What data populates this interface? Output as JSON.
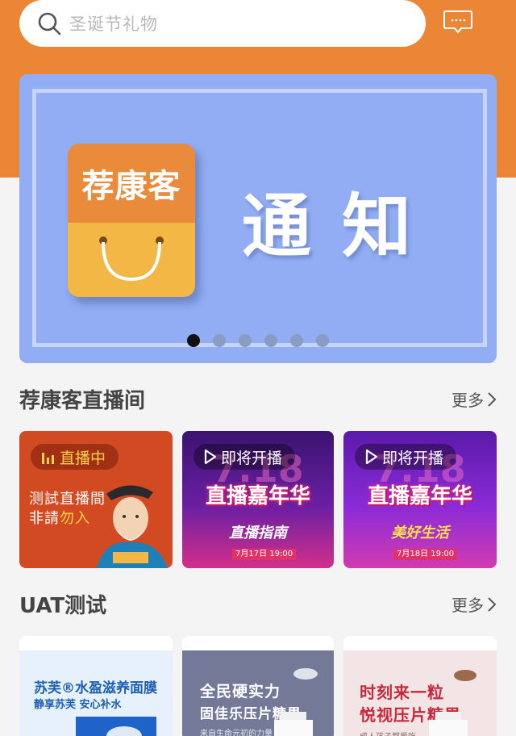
{
  "search": {
    "placeholder": "圣诞节礼物"
  },
  "banner": {
    "logo_text": "荐康客",
    "notice_text": "通知",
    "dots_count": 6,
    "active_dot": 0
  },
  "live_section": {
    "title": "荐康客直播间",
    "more_label": "更多",
    "cards": [
      {
        "status": "直播中",
        "line1": "测試直播間",
        "line2_prefix": "非請",
        "line2_highlight": "勿入"
      },
      {
        "status": "即将开播",
        "big_num": "7.18",
        "title": "直播嘉年华",
        "subtitle": "直播指南",
        "date": "7月17日 19:00"
      },
      {
        "status": "即将开播",
        "big_num": "7.18",
        "title": "直播嘉年华",
        "subtitle": "美好生活",
        "date": "7月18日 19:00"
      }
    ]
  },
  "uat_section": {
    "title": "UAT测试",
    "more_label": "更多",
    "products": [
      {
        "line1": "苏芙®水盈滋养面膜",
        "line2": "静享苏芙 安心补水"
      },
      {
        "line1": "全民硬实力",
        "line2": "固佳乐压片糖果",
        "line3": "来自生命元初的力量"
      },
      {
        "line1": "时刻来一粒",
        "line2": "悦视压片糖果",
        "line3": "成人孩子都爱吃"
      }
    ]
  },
  "colors": {
    "header": "#ea8636",
    "banner": "#92adf3",
    "accent": "#d24a22"
  }
}
